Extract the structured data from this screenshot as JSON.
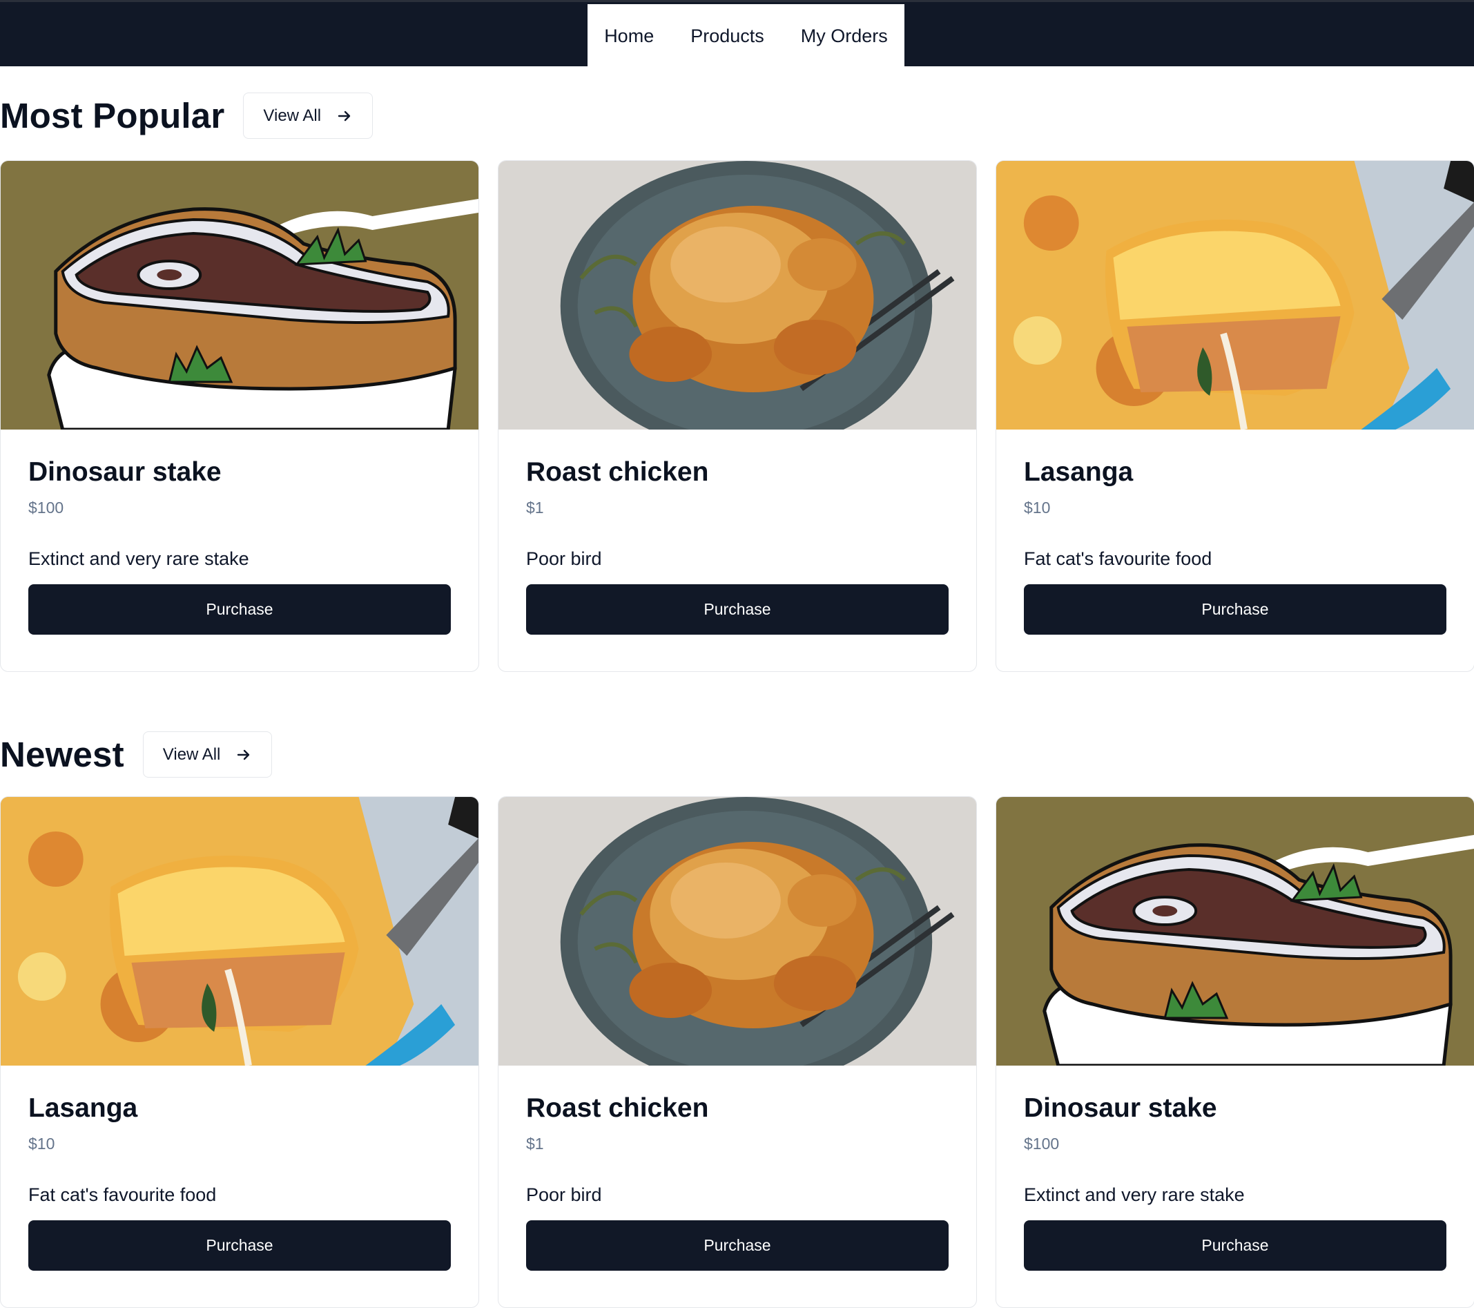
{
  "nav": {
    "items": [
      "Home",
      "Products",
      "My Orders"
    ]
  },
  "sections": [
    {
      "title": "Most Popular",
      "view_all": "View All",
      "products": [
        {
          "name": "Dinosaur stake",
          "price": "$100",
          "description": "Extinct and very rare stake",
          "button": "Purchase",
          "image": "dinosaur-steak-image"
        },
        {
          "name": "Roast chicken",
          "price": "$1",
          "description": "Poor bird",
          "button": "Purchase",
          "image": "roast-chicken-image"
        },
        {
          "name": "Lasanga",
          "price": "$10",
          "description": "Fat cat's favourite food",
          "button": "Purchase",
          "image": "lasagna-image"
        }
      ]
    },
    {
      "title": "Newest",
      "view_all": "View All",
      "products": [
        {
          "name": "Lasanga",
          "price": "$10",
          "description": "Fat cat's favourite food",
          "button": "Purchase",
          "image": "lasagna-image"
        },
        {
          "name": "Roast chicken",
          "price": "$1",
          "description": "Poor bird",
          "button": "Purchase",
          "image": "roast-chicken-image"
        },
        {
          "name": "Dinosaur stake",
          "price": "$100",
          "description": "Extinct and very rare stake",
          "button": "Purchase",
          "image": "dinosaur-steak-image"
        }
      ]
    }
  ],
  "colors": {
    "header_bg": "#111827",
    "button_bg": "#111827",
    "price_text": "#64748b"
  }
}
